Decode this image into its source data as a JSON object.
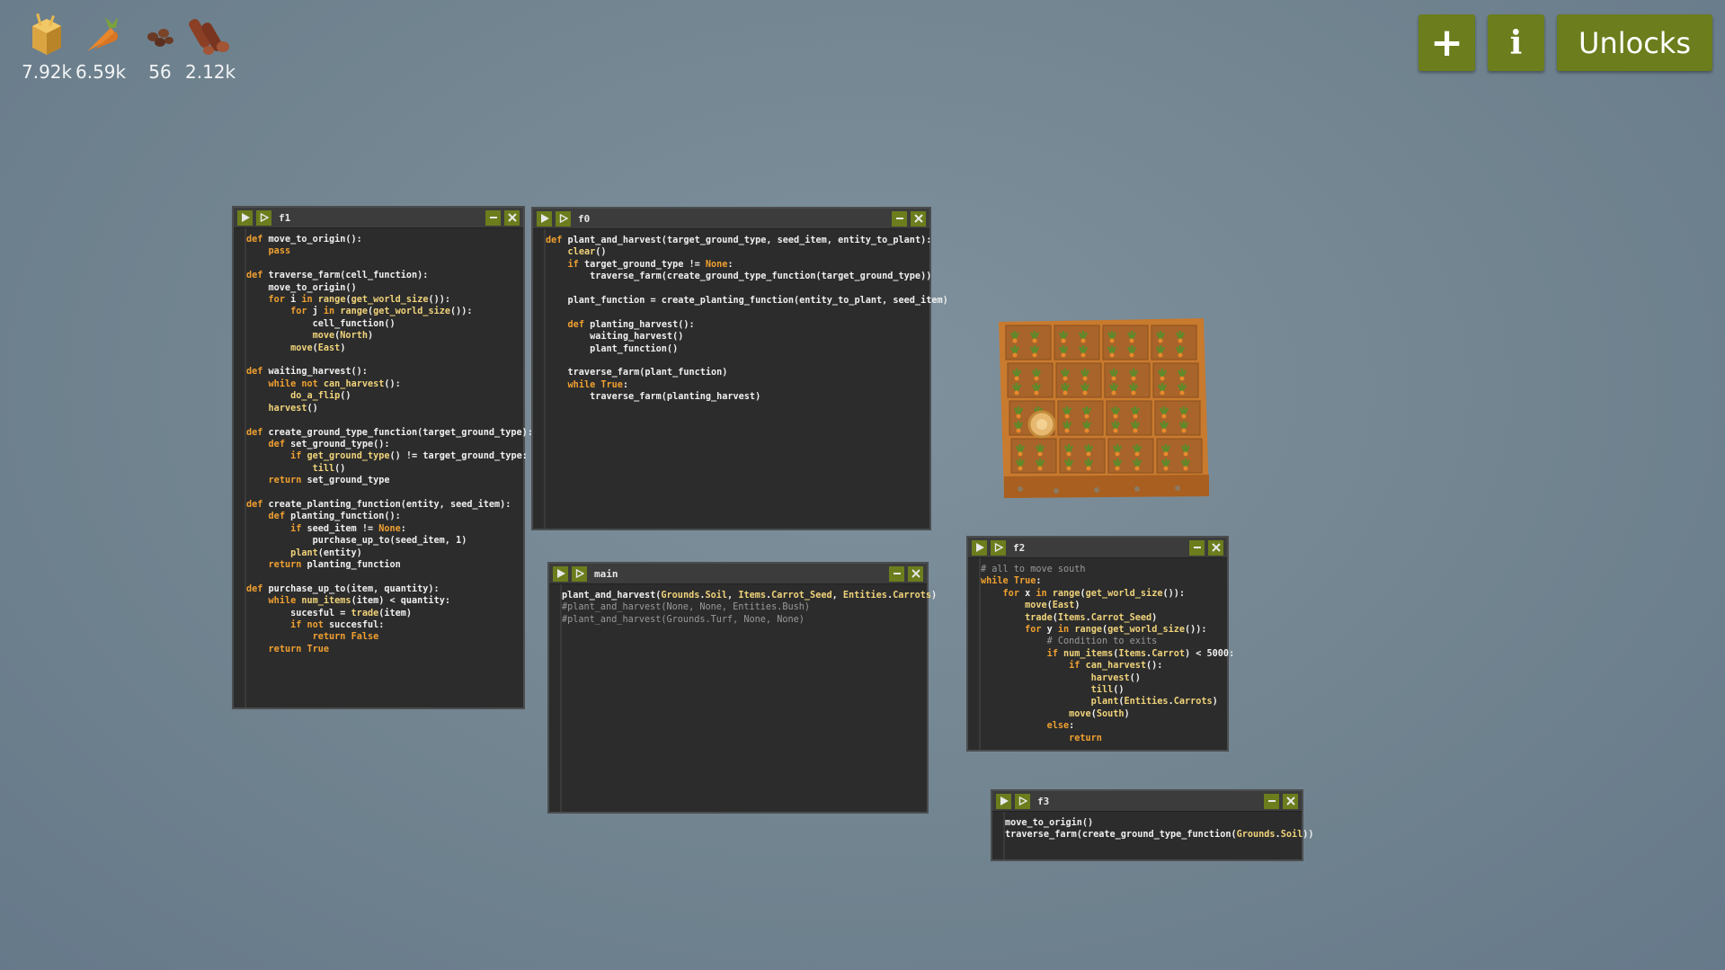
{
  "resources": [
    {
      "icon": "hay-icon",
      "value": "7.92k"
    },
    {
      "icon": "carrot-icon",
      "value": "6.59k"
    },
    {
      "icon": "seeds-icon",
      "value": "56"
    },
    {
      "icon": "wood-icon",
      "value": "2.12k"
    }
  ],
  "toolbar": {
    "add_label": "+",
    "info_label": "i",
    "unlocks_label": "Unlocks"
  },
  "colors": {
    "button_green": "#6b7d1c",
    "background": "#70838f",
    "keyword": "#f0a030",
    "builtin": "#f0d37a",
    "comment": "#9a9a9a"
  },
  "windows": {
    "f1": {
      "name": "f1",
      "code": "def move_to_origin():\n    pass\n\ndef traverse_farm(cell_function):\n    move_to_origin()\n    for i in range(get_world_size()):\n        for j in range(get_world_size()):\n            cell_function()\n            move(North)\n        move(East)\n\ndef waiting_harvest():\n    while not can_harvest():\n        do_a_flip()\n    harvest()\n\ndef create_ground_type_function(target_ground_type):\n    def set_ground_type():\n        if get_ground_type() != target_ground_type:\n            till()\n    return set_ground_type\n\ndef create_planting_function(entity, seed_item):\n    def planting_function():\n        if seed_item != None:\n            purchase_up_to(seed_item, 1)\n        plant(entity)\n    return planting_function\n\ndef purchase_up_to(item, quantity):\n    while num_items(item) < quantity:\n        sucesful = trade(item)\n        if not succesful:\n            return False\n    return True"
    },
    "f0": {
      "name": "f0",
      "code": "def plant_and_harvest(target_ground_type, seed_item, entity_to_plant):\n    clear()\n    if target_ground_type != None:\n        traverse_farm(create_ground_type_function(target_ground_type))\n\n    plant_function = create_planting_function(entity_to_plant, seed_item)\n\n    def planting_harvest():\n        waiting_harvest()\n        plant_function()\n\n    traverse_farm(plant_function)\n    while True:\n        traverse_farm(planting_harvest)"
    },
    "main": {
      "name": "main",
      "code": "plant_and_harvest(Grounds.Soil, Items.Carrot_Seed, Entities.Carrots)\n#plant_and_harvest(None, None, Entities.Bush)\n#plant_and_harvest(Grounds.Turf, None, None)"
    },
    "f2": {
      "name": "f2",
      "code": "# all to move south\nwhile True:\n    for x in range(get_world_size()):\n        move(East)\n        trade(Items.Carrot_Seed)\n        for y in range(get_world_size()):\n            # Condition to exits\n            if num_items(Items.Carrot) < 5000:\n                if can_harvest():\n                    harvest()\n                    till()\n                    plant(Entities.Carrots)\n                move(South)\n            else:\n                return"
    },
    "f3": {
      "name": "f3",
      "code": "move_to_origin()\ntraverse_farm(create_ground_type_function(Grounds.Soil))"
    }
  }
}
